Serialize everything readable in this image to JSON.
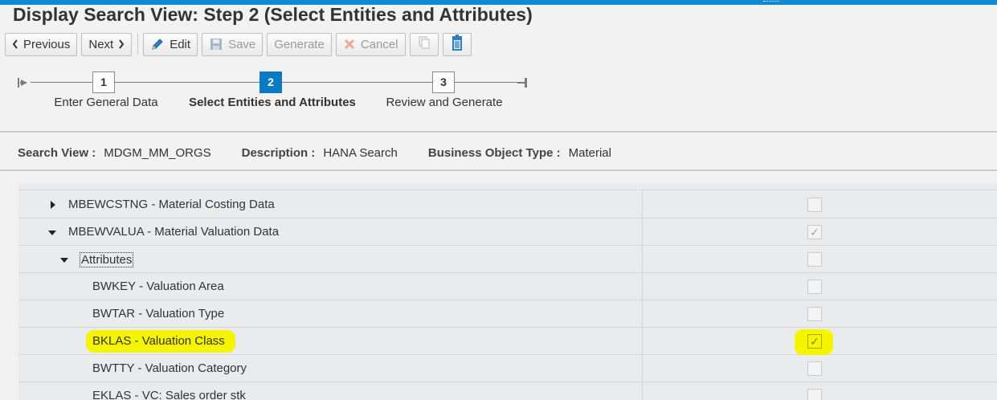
{
  "page": {
    "title": "Display Search View: Step 2  (Select Entities and Attributes)",
    "colors": {
      "accent": "#0f88d5",
      "active_step": "#0a7bc1",
      "highlight": "#f5f500"
    }
  },
  "toolbar": {
    "previous": "Previous",
    "next": "Next",
    "edit": "Edit",
    "save": "Save",
    "generate": "Generate",
    "cancel": "Cancel",
    "icons": [
      "chevron-left-icon",
      "chevron-right-icon",
      "pencil-icon",
      "floppy-disk-icon",
      "cross-icon",
      "copy-icon",
      "trash-icon"
    ]
  },
  "roadmap": {
    "steps": [
      {
        "number": "1",
        "label": "Enter General Data",
        "state": "done"
      },
      {
        "number": "2",
        "label": "Select Entities and Attributes",
        "state": "active"
      },
      {
        "number": "3",
        "label": "Review and Generate",
        "state": "pending"
      }
    ]
  },
  "info": {
    "search_view_label": "Search View :",
    "search_view_value": "MDGM_MM_ORGS",
    "description_label": "Description :",
    "description_value": "HANA Search",
    "bo_type_label": "Business Object Type :",
    "bo_type_value": "Material"
  },
  "tree": {
    "rows": [
      {
        "text": "MBEWCSTNG - Material Costing Data",
        "level": 1,
        "expander": "collapsed",
        "checked": false,
        "highlighted": false
      },
      {
        "text": "MBEWVALUA - Material Valuation Data",
        "level": 1,
        "expander": "expanded",
        "checked": true,
        "highlighted": false
      },
      {
        "text": "Attributes",
        "level": 2,
        "expander": "expanded",
        "checked": false,
        "highlighted": false,
        "focused": true
      },
      {
        "text": "BWKEY - Valuation Area",
        "level": 3,
        "expander": "none",
        "checked": false,
        "highlighted": false
      },
      {
        "text": "BWTAR - Valuation Type",
        "level": 3,
        "expander": "none",
        "checked": false,
        "highlighted": false
      },
      {
        "text": "BKLAS - Valuation Class",
        "level": 3,
        "expander": "none",
        "checked": true,
        "highlighted": true
      },
      {
        "text": "BWTTY - Valuation Category",
        "level": 3,
        "expander": "none",
        "checked": false,
        "highlighted": false
      },
      {
        "text": "EKLAS - VC: Sales order stk",
        "level": 3,
        "expander": "none",
        "checked": false,
        "highlighted": false
      }
    ]
  }
}
